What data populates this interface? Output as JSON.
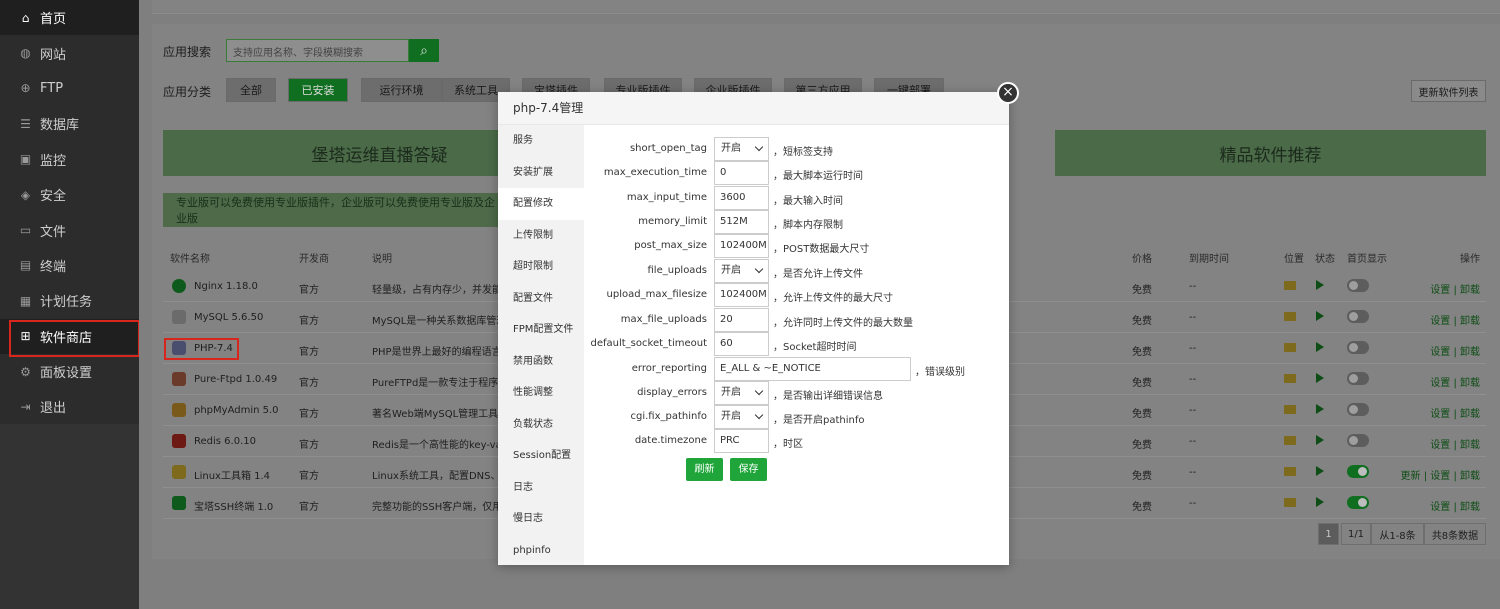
{
  "sidebar": {
    "items": [
      {
        "label": "首页",
        "icon": "home-icon"
      },
      {
        "label": "网站",
        "icon": "globe-icon"
      },
      {
        "label": "FTP",
        "icon": "ftp-icon"
      },
      {
        "label": "数据库",
        "icon": "database-icon"
      },
      {
        "label": "监控",
        "icon": "monitor-icon"
      },
      {
        "label": "安全",
        "icon": "shield-icon"
      },
      {
        "label": "文件",
        "icon": "folder-icon"
      },
      {
        "label": "终端",
        "icon": "terminal-icon"
      },
      {
        "label": "计划任务",
        "icon": "clock-icon"
      },
      {
        "label": "软件商店",
        "icon": "apps-icon"
      },
      {
        "label": "面板设置",
        "icon": "gear-icon"
      },
      {
        "label": "退出",
        "icon": "logout-icon"
      }
    ]
  },
  "search": {
    "label": "应用搜索",
    "placeholder": "支持应用名称、字段模糊搜索"
  },
  "categories": {
    "label": "应用分类",
    "items": [
      "全部",
      "已安装",
      "运行环境",
      "系统工具",
      "宝塔插件",
      "专业版插件",
      "企业版插件",
      "第三方应用",
      "一键部署"
    ],
    "update_label": "更新软件列表"
  },
  "banners": {
    "left": "堡塔运维直播答疑",
    "right": "精品软件推荐"
  },
  "notice": "专业版可以免费使用专业版插件，企业版可以免费使用专业版及企业版",
  "table": {
    "headers": {
      "name": "软件名称",
      "dev": "开发商",
      "desc": "说明",
      "price": "价格",
      "expire": "到期时间",
      "location": "位置",
      "status": "状态",
      "home": "首页显示",
      "ops": "操作"
    },
    "rows": [
      {
        "name": "Nginx 1.18.0",
        "dev": "官方",
        "desc": "轻量级，占有内存少，并发能力",
        "price": "免费",
        "expire": "--",
        "home_on": false,
        "ops": "设置 | 卸载",
        "icon": "nginx-icon"
      },
      {
        "name": "MySQL 5.6.50",
        "dev": "官方",
        "desc": "MySQL是一种关系数据库管理",
        "price": "免费",
        "expire": "--",
        "home_on": false,
        "ops": "设置 | 卸载",
        "icon": "mysql-icon"
      },
      {
        "name": "PHP-7.4",
        "dev": "官方",
        "desc": "PHP是世界上最好的编程语言",
        "price": "免费",
        "expire": "--",
        "home_on": false,
        "ops": "设置 | 卸载",
        "icon": "php-icon"
      },
      {
        "name": "Pure-Ftpd 1.0.49",
        "dev": "官方",
        "desc": "PureFTPd是一款专注于程序健",
        "price": "免费",
        "expire": "--",
        "home_on": false,
        "ops": "设置 | 卸载",
        "icon": "ftp-logo-icon"
      },
      {
        "name": "phpMyAdmin 5.0",
        "dev": "官方",
        "desc": "著名Web端MySQL管理工具",
        "price": "免费",
        "expire": "--",
        "home_on": false,
        "ops": "设置 | 卸载",
        "icon": "phpmyadmin-icon"
      },
      {
        "name": "Redis 6.0.10",
        "dev": "官方",
        "desc": "Redis是一个高性能的key-valu",
        "price": "免费",
        "expire": "--",
        "home_on": false,
        "ops": "设置 | 卸载",
        "icon": "redis-icon"
      },
      {
        "name": "Linux工具箱 1.4",
        "dev": "官方",
        "desc": "Linux系统工具，配置DNS、S",
        "price": "免费",
        "expire": "--",
        "home_on": true,
        "ops": "更新 | 设置 | 卸载",
        "icon": "toolbox-icon"
      },
      {
        "name": "宝塔SSH终端 1.0",
        "dev": "官方",
        "desc": "完整功能的SSH客户端，仅用于",
        "price": "免费",
        "expire": "--",
        "home_on": true,
        "ops": "设置 | 卸载",
        "icon": "ssh-terminal-icon"
      }
    ]
  },
  "pager": {
    "current": "1",
    "pages": "1/1",
    "range": "从1-8条",
    "total": "共8条数据"
  },
  "modal": {
    "title": "php-7.4管理",
    "close": "×",
    "menu": [
      "服务",
      "安装扩展",
      "配置修改",
      "上传限制",
      "超时限制",
      "配置文件",
      "FPM配置文件",
      "禁用函数",
      "性能调整",
      "负载状态",
      "Session配置",
      "日志",
      "慢日志",
      "phpinfo"
    ],
    "active_menu": "配置修改",
    "fields": [
      {
        "label": "short_open_tag",
        "value": "开启",
        "type": "select",
        "hint": "，短标签支持"
      },
      {
        "label": "max_execution_time",
        "value": "0",
        "type": "input",
        "hint": "，最大脚本运行时间"
      },
      {
        "label": "max_input_time",
        "value": "3600",
        "type": "input",
        "hint": "，最大输入时间"
      },
      {
        "label": "memory_limit",
        "value": "512M",
        "type": "input",
        "hint": "，脚本内存限制"
      },
      {
        "label": "post_max_size",
        "value": "102400M",
        "type": "input",
        "hint": "，POST数据最大尺寸"
      },
      {
        "label": "file_uploads",
        "value": "开启",
        "type": "select",
        "hint": "，是否允许上传文件"
      },
      {
        "label": "upload_max_filesize",
        "value": "102400M",
        "type": "input",
        "hint": "，允许上传文件的最大尺寸"
      },
      {
        "label": "max_file_uploads",
        "value": "20",
        "type": "input",
        "hint": "，允许同时上传文件的最大数量"
      },
      {
        "label": "default_socket_timeout",
        "value": "60",
        "type": "input",
        "hint": "，Socket超时时间"
      },
      {
        "label": "error_reporting",
        "value": "E_ALL & ~E_NOTICE",
        "type": "wide",
        "hint": "，错误级别"
      },
      {
        "label": "display_errors",
        "value": "开启",
        "type": "select",
        "hint": "，是否输出详细错误信息"
      },
      {
        "label": "cgi.fix_pathinfo",
        "value": "开启",
        "type": "select",
        "hint": "，是否开启pathinfo"
      },
      {
        "label": "date.timezone",
        "value": "PRC",
        "type": "input",
        "hint": "，时区"
      }
    ],
    "refresh_label": "刷新",
    "save_label": "保存"
  },
  "colors": {
    "accent": "#20a53a",
    "highlight_border": "#d9261c",
    "sidebar_bg": "#2c2c2c"
  }
}
